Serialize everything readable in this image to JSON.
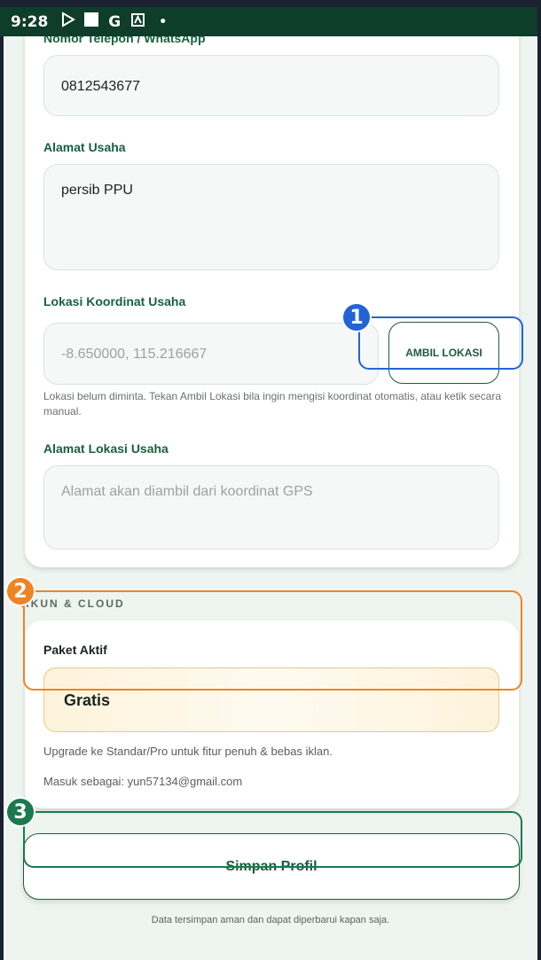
{
  "status_bar": {
    "time": "9:28"
  },
  "form": {
    "phone_label": "Nomor Telepon / WhatsApp",
    "phone_value": "0812543677",
    "address_label": "Alamat Usaha",
    "address_value": "persib PPU",
    "coord_label": "Lokasi Koordinat Usaha",
    "coord_placeholder": "-8.650000, 115.216667",
    "get_location_button": "AMBIL LOKASI",
    "coord_helper": "Lokasi belum diminta. Tekan Ambil Lokasi bila ingin mengisi koordinat otomatis, atau ketik secara manual.",
    "gps_address_label": "Alamat Lokasi Usaha",
    "gps_address_placeholder": "Alamat akan diambil dari koordinat GPS"
  },
  "account": {
    "section_title": "AKUN & CLOUD",
    "active_plan_label": "Paket Aktif",
    "plan_name": "Gratis",
    "upgrade_text": "Upgrade ke Standar/Pro untuk fitur penuh & bebas iklan.",
    "logged_in_text": "Masuk sebagai: yun57134@gmail.com"
  },
  "save_button": "Simpan Profil",
  "footer_note": "Data tersimpan aman dan dapat diperbarui kapan saja.",
  "annotations": [
    {
      "number": "1",
      "color": "#2463d6"
    },
    {
      "number": "2",
      "color": "#ee8424"
    },
    {
      "number": "3",
      "color": "#1b7a4d"
    }
  ]
}
